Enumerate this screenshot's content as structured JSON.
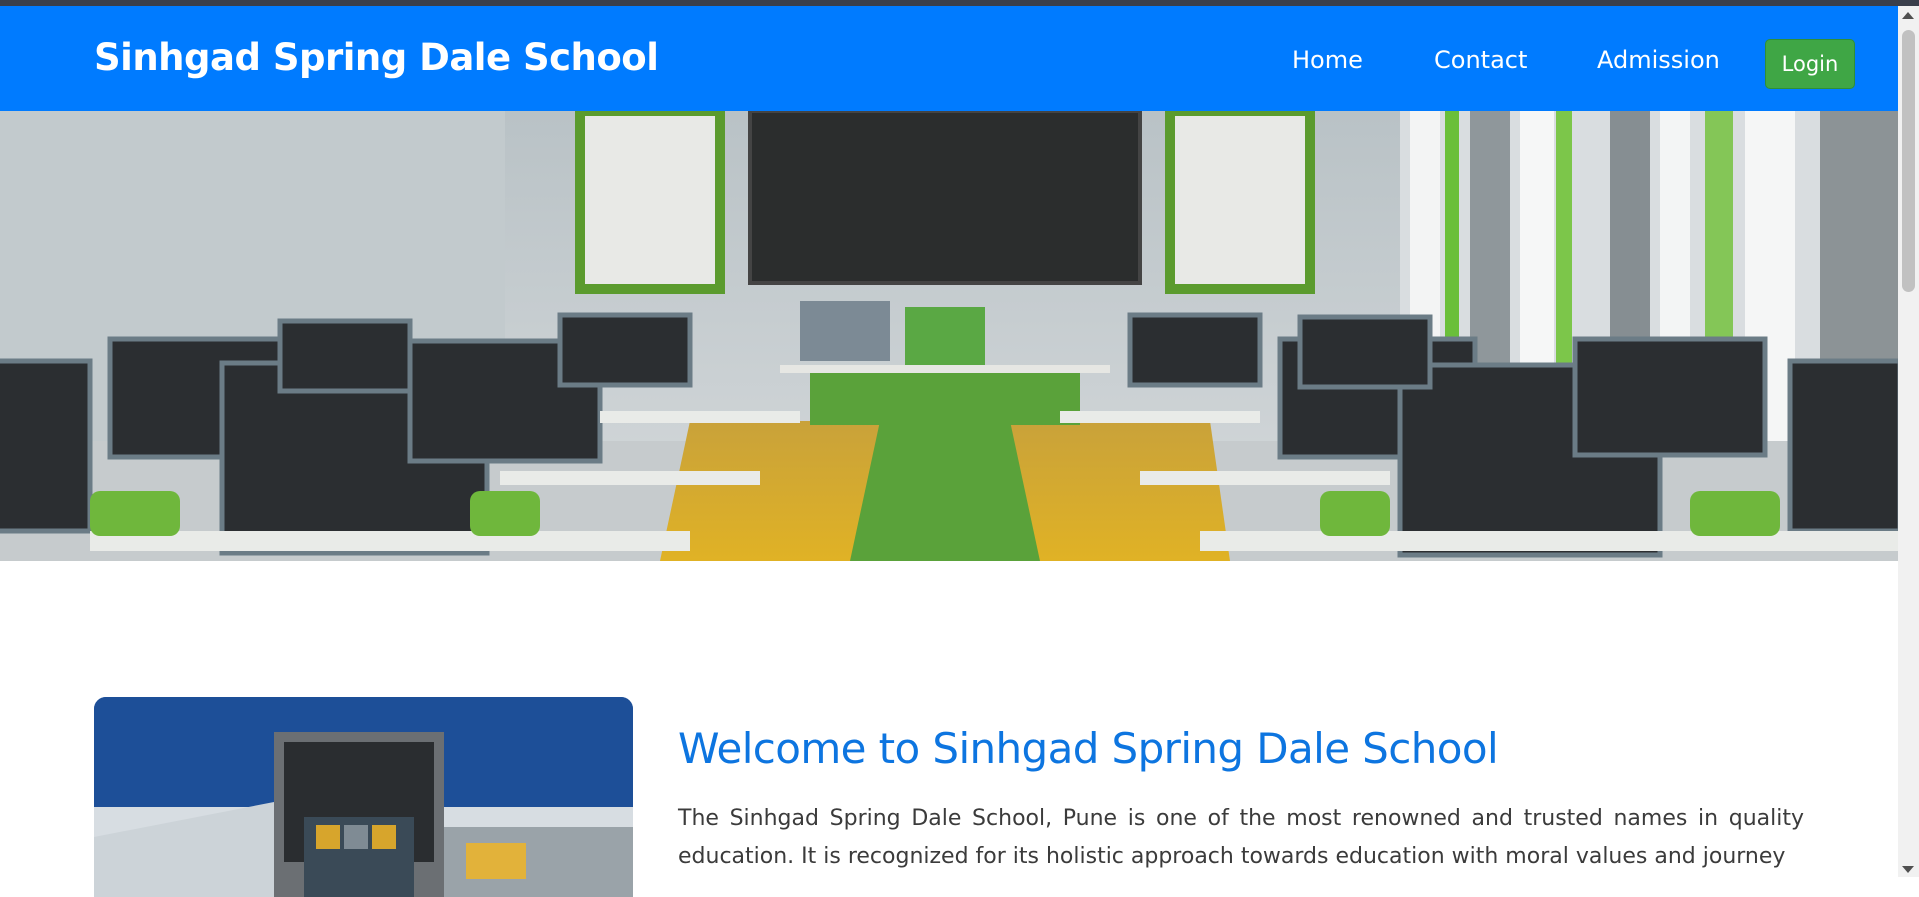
{
  "navbar": {
    "brand": "Sinhgad Spring Dale School",
    "links": [
      {
        "label": "Home"
      },
      {
        "label": "Contact"
      },
      {
        "label": "Admission"
      }
    ],
    "login_label": "Login"
  },
  "hero": {
    "icon": "classroom-photo"
  },
  "about": {
    "image_icon": "school-building-photo",
    "title": "Welcome to Sinhgad Spring Dale School",
    "paragraph": "The Sinhgad Spring Dale School, Pune is one of the most renowned and trusted names in quality education. It is recognized for its holistic approach towards education with moral values and journey"
  },
  "colors": {
    "navbar": "#007bff",
    "login_button": "#3fa645",
    "title": "#0d75e0",
    "text": "#3b3b3b"
  }
}
